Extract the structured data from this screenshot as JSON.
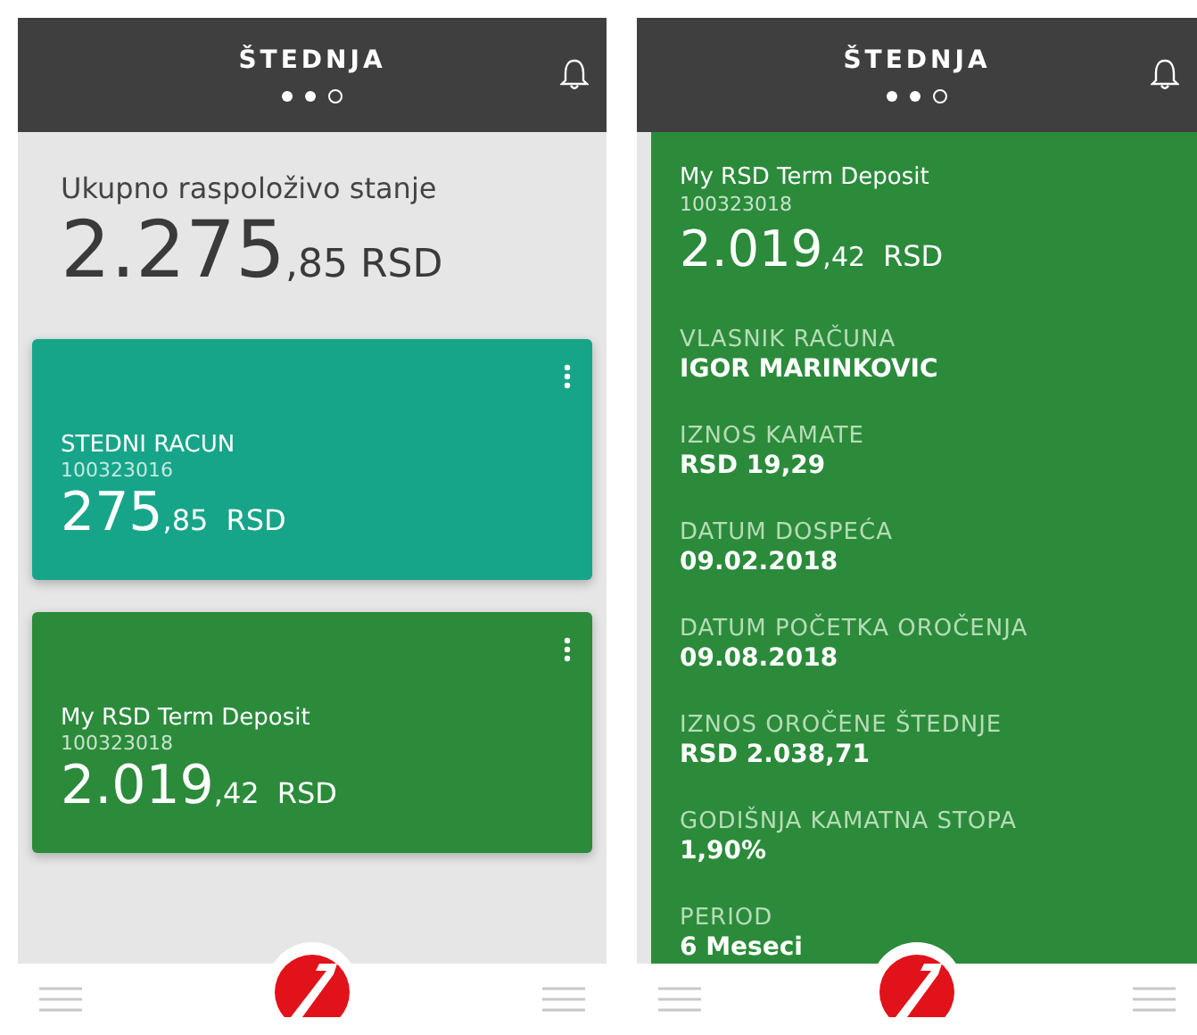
{
  "screens": [
    {
      "kind": "overview",
      "header": {
        "title": "ŠTEDNJA",
        "pages": [
          {
            "selected": false
          },
          {
            "selected": false
          },
          {
            "selected": true
          }
        ]
      },
      "summary": {
        "label": "Ukupno raspoloživo stanje",
        "integer": "2.275",
        "decimals": ",85",
        "currency": "RSD"
      },
      "accounts": [
        {
          "name": "STEDNI RACUN",
          "number": "100323016",
          "integer": "275",
          "decimals": ",85",
          "currency": "RSD",
          "color": "#17a589"
        },
        {
          "name": "My RSD Term Deposit",
          "number": "100323018",
          "integer": "2.019",
          "decimals": ",42",
          "currency": "RSD",
          "color": "#2b8b3b"
        }
      ]
    },
    {
      "kind": "details",
      "header": {
        "title": "ŠTEDNJA",
        "pages": [
          {
            "selected": false
          },
          {
            "selected": false
          },
          {
            "selected": true
          }
        ]
      },
      "account": {
        "name": "My RSD Term Deposit",
        "number": "100323018",
        "integer": "2.019",
        "decimals": ",42",
        "currency": "RSD"
      },
      "fields": [
        {
          "label": "VLASNIK RAČUNA",
          "value": "IGOR MARINKOVIC"
        },
        {
          "label": "IZNOS KAMATE",
          "value": "RSD 19,29"
        },
        {
          "label": "DATUM DOSPEĆA",
          "value": "09.02.2018"
        },
        {
          "label": "DATUM POČETKA OROČENJA",
          "value": "09.08.2018"
        },
        {
          "label": "IZNOS OROČENE ŠTEDNJE",
          "value": "RSD 2.038,71"
        },
        {
          "label": "GODIŠNJA KAMATNA STOPA",
          "value": "1,90%"
        },
        {
          "label": "PERIOD",
          "value": "6 Meseci"
        }
      ]
    }
  ]
}
